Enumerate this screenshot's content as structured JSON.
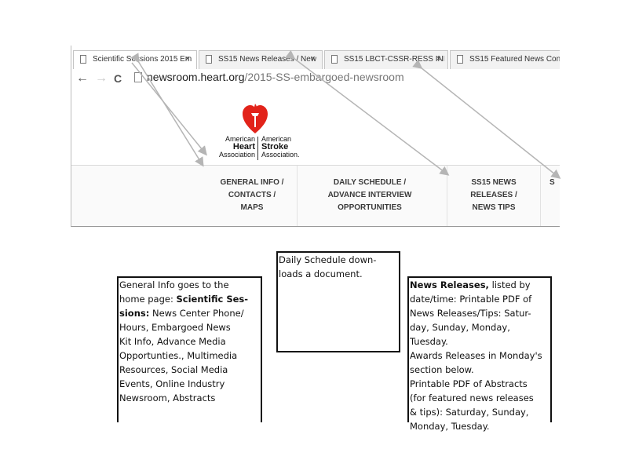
{
  "browser": {
    "tabs": [
      {
        "title": "Scientific Sessions 2015 Em",
        "active": true,
        "icon": "document-icon"
      },
      {
        "title": "SS15 News Releases / New",
        "active": false,
        "icon": "document-icon"
      },
      {
        "title": "SS15 LBCT-CSSR-RESS INF",
        "active": false,
        "icon": "document-icon"
      },
      {
        "title": "SS15 Featured News Conf",
        "active": false,
        "icon": "document-icon"
      }
    ],
    "close_glyph": "×",
    "back_glyph": "←",
    "forward_glyph": "→",
    "reload_glyph": "C",
    "url_host": "newsroom.heart.org",
    "url_path": "/2015-SS-embargoed-newsroom"
  },
  "site": {
    "logo": {
      "left_line1": "American",
      "left_line2": "Heart",
      "left_line3": "Association",
      "right_line1": "American",
      "right_line2": "Stroke",
      "right_line3": "Association.",
      "heart_color": "#e2231a"
    },
    "nav": [
      {
        "line1": "GENERAL INFO /",
        "line2": "CONTACTS /",
        "line3": "MAPS"
      },
      {
        "line1": "DAILY SCHEDULE /",
        "line2": "ADVANCE INTERVIEW",
        "line3": "OPPORTUNITIES"
      },
      {
        "line1": "SS15 NEWS",
        "line2": "RELEASES /",
        "line3": "NEWS TIPS"
      },
      {
        "line1": "S",
        "line2": "",
        "line3": ""
      }
    ]
  },
  "annotations": {
    "general": {
      "lines": [
        "General Info goes to the",
        "home page: ",
        "sions: ",
        "Hours, Embargoed News",
        "Kit Info,  Advance Media",
        "Opportunties., Multimedia",
        "Resources, Social Media",
        "Events, Online Industry",
        "Newsroom, Abstracts"
      ],
      "bold_1": "Scientific Ses-",
      "bold_2": "sions:",
      "rest_2": " News Center Phone/"
    },
    "schedule": {
      "line1": "Daily Schedule down-",
      "line2": "loads a document."
    },
    "news": {
      "bold": "News Releases,",
      "after_bold": " listed by",
      "lines": [
        "date/time: Printable PDF of",
        "News Releases/Tips: Satur-",
        "day, Sunday, Monday, Tuesday.",
        "Awards Releases in Monday's",
        "section below.",
        "Printable PDF of Abstracts",
        "(for featured news releases",
        "& tips): Saturday, Sunday,",
        "Monday, Tuesday."
      ]
    }
  },
  "colors": {
    "arrow": "#b5b5b5",
    "box_border": "#111111"
  }
}
